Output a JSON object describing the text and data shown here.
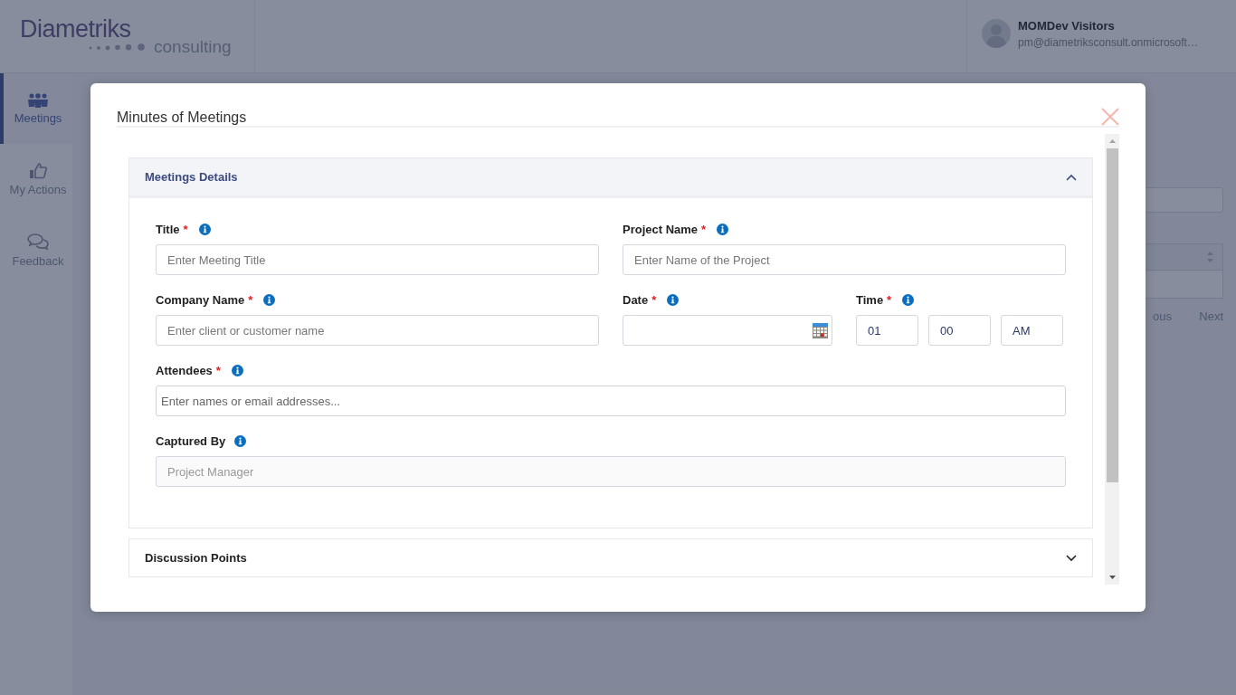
{
  "header": {
    "logo": {
      "name": "Diametriks",
      "tagline": "consulting"
    },
    "user": {
      "name": "MOMDev Visitors",
      "email": "pm@diametriksconsult.onmicrosoft…"
    }
  },
  "sidebar": {
    "items": [
      {
        "label": "Meetings",
        "kind": "people",
        "selected": true
      },
      {
        "label": "My Actions",
        "kind": "thumb",
        "selected": false
      },
      {
        "label": "Feedback",
        "kind": "chat",
        "selected": false
      }
    ]
  },
  "pagination": {
    "previous": "ous",
    "next": "Next"
  },
  "modal": {
    "title": "Minutes of Meetings",
    "sections": [
      {
        "title": "Meetings Details",
        "expanded": true,
        "fields": [
          {
            "kind": "text",
            "label": "Title",
            "required_mark": "*",
            "placeholder": "Enter Meeting Title"
          },
          {
            "kind": "text",
            "label": "Project Name",
            "required_mark": "*",
            "placeholder": "Enter Name of the Project"
          },
          {
            "kind": "text",
            "label": "Company Name",
            "required_mark": "*",
            "placeholder": "Enter client or customer name"
          },
          {
            "kind": "date",
            "label": "Date",
            "required_mark": "*"
          },
          {
            "kind": "time",
            "label": "Time",
            "required_mark": "*",
            "values": [
              "01",
              "00",
              "AM"
            ]
          },
          {
            "kind": "tags",
            "label": "Attendees",
            "required_mark": "*",
            "placeholder": "Enter names or email addresses..."
          },
          {
            "kind": "text",
            "label": "Captured By",
            "value": "Project Manager",
            "disabled": true
          }
        ]
      },
      {
        "title": "Discussion Points",
        "expanded": false
      }
    ]
  }
}
